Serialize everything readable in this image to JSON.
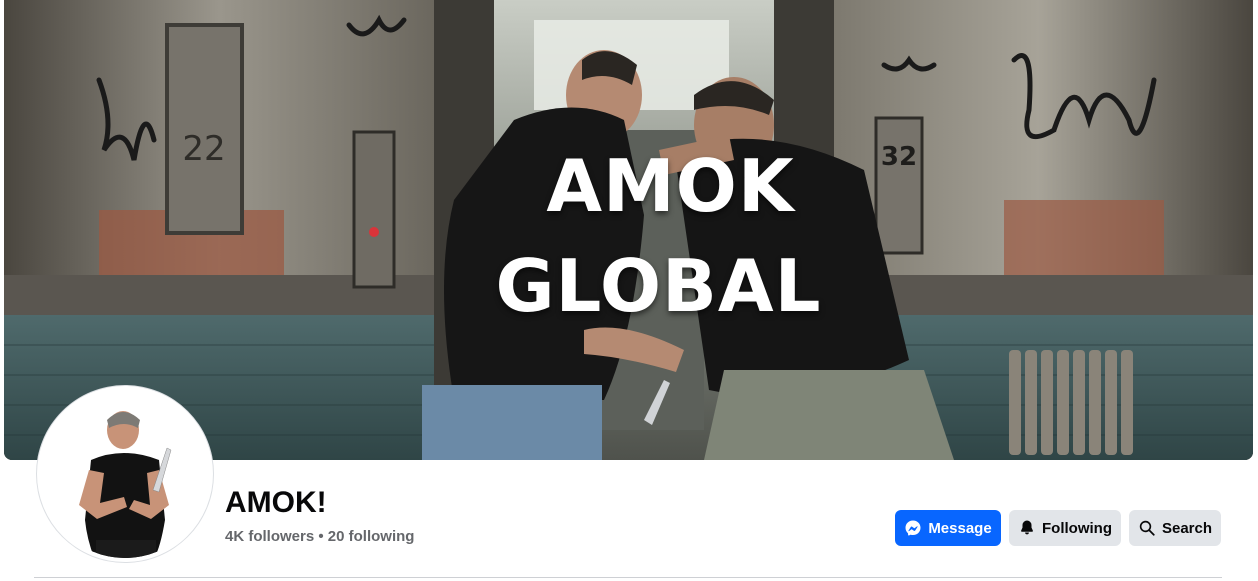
{
  "cover": {
    "title_line1": "AMOK",
    "title_line2": "GLOBAL",
    "sign_left": "22",
    "sign_right": "32"
  },
  "profile": {
    "name": "AMOK!",
    "followers": "4K followers",
    "separator": " • ",
    "following": "20 following"
  },
  "actions": {
    "message_label": "Message",
    "following_label": "Following",
    "search_label": "Search"
  },
  "icons": {
    "message": "messenger-icon",
    "following": "bell-icon",
    "search": "search-icon"
  },
  "colors": {
    "primary": "#0866ff",
    "secondary_button": "#e2e5e9",
    "text": "#080809",
    "muted": "#65676b"
  }
}
